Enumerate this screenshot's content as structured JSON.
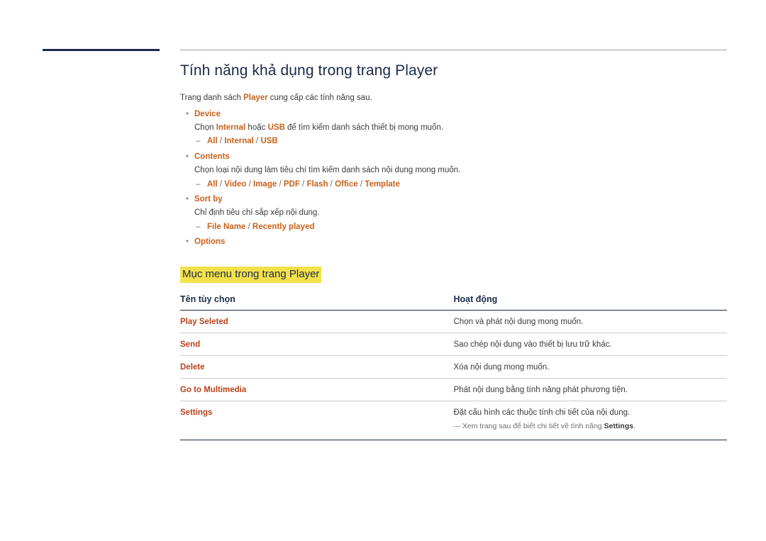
{
  "title": "Tính năng khả dụng trong trang Player",
  "intro": {
    "before": "Trang danh sách ",
    "keyword": "Player",
    "after": " cung cấp các tính năng sau."
  },
  "features": [
    {
      "name": "Device",
      "description_parts": {
        "p1": "Chọn ",
        "k1": "Internal",
        "p2": " hoặc ",
        "k2": "USB",
        "p3": " để tìm kiếm danh sách thiết bị mong muốn."
      },
      "options": [
        "All",
        "Internal",
        "USB"
      ]
    },
    {
      "name": "Contents",
      "description": "Chọn loại nội dung làm tiêu chí tìm kiếm danh sách nội dung mong muốn.",
      "options": [
        "All",
        "Video",
        "Image",
        "PDF",
        "Flash",
        "Office",
        "Template"
      ]
    },
    {
      "name": "Sort by",
      "description": "Chỉ định tiêu chí sắp xếp nội dung.",
      "options": [
        "File Name",
        "Recently played"
      ]
    },
    {
      "name": "Options",
      "description": "",
      "options": []
    }
  ],
  "section_title": "Mục menu trong trang Player",
  "table": {
    "headers": [
      "Tên tùy chọn",
      "Hoạt động"
    ],
    "rows": [
      {
        "name": "Play Seleted",
        "action": "Chọn và phát nội dung mong muốn."
      },
      {
        "name": "Send",
        "action": "Sao chép nội dung vào thiết bị lưu trữ khác."
      },
      {
        "name": "Delete",
        "action": "Xóa nội dung mong muốn."
      },
      {
        "name": "Go to Multimedia",
        "action": "Phát nội dung bằng tính năng phát phương tiện."
      },
      {
        "name": "Settings",
        "action": "Đặt cấu hình các thuộc tính chi tiết của nội dung."
      }
    ],
    "note": {
      "dash": "―",
      "before": " Xem trang sau để biết chi tiết về tính năng ",
      "keyword": "Settings",
      "after": "."
    }
  }
}
